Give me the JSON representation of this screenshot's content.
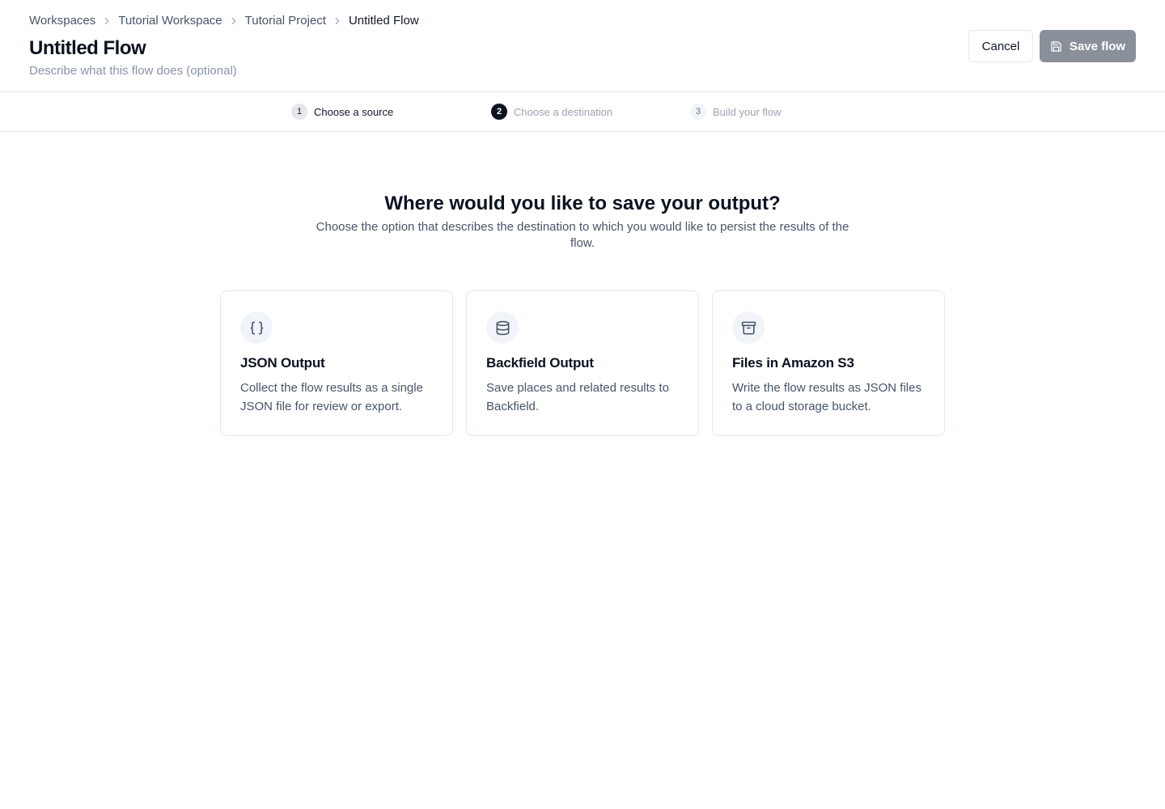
{
  "breadcrumb": {
    "items": [
      "Workspaces",
      "Tutorial Workspace",
      "Tutorial Project",
      "Untitled Flow"
    ]
  },
  "header": {
    "title": "Untitled Flow",
    "description_placeholder": "Describe what this flow does (optional)"
  },
  "actions": {
    "cancel_label": "Cancel",
    "save_label": "Save flow",
    "save_icon": "save-icon"
  },
  "steps": [
    {
      "number": "1",
      "label": "Choose a source",
      "state": "completed"
    },
    {
      "number": "2",
      "label": "Choose a destination",
      "state": "current"
    },
    {
      "number": "3",
      "label": "Build your flow",
      "state": "upcoming"
    }
  ],
  "main": {
    "heading": "Where would you like to save your output?",
    "subheading": "Choose the option that describes the destination to which you would like to persist the results of the flow.",
    "options": [
      {
        "icon": "braces-icon",
        "title": "JSON Output",
        "description": "Collect the flow results as a single JSON file for review or export."
      },
      {
        "icon": "database-icon",
        "title": "Backfield Output",
        "description": "Save places and related results to Backfield."
      },
      {
        "icon": "archive-icon",
        "title": "Files in Amazon S3",
        "description": "Write the flow results as JSON files to a cloud storage bucket."
      }
    ]
  },
  "colors": {
    "primary_dark": "#0b1220",
    "save_button_disabled": "#8a909a",
    "muted_text": "#475569",
    "border": "#e2e8f0"
  }
}
